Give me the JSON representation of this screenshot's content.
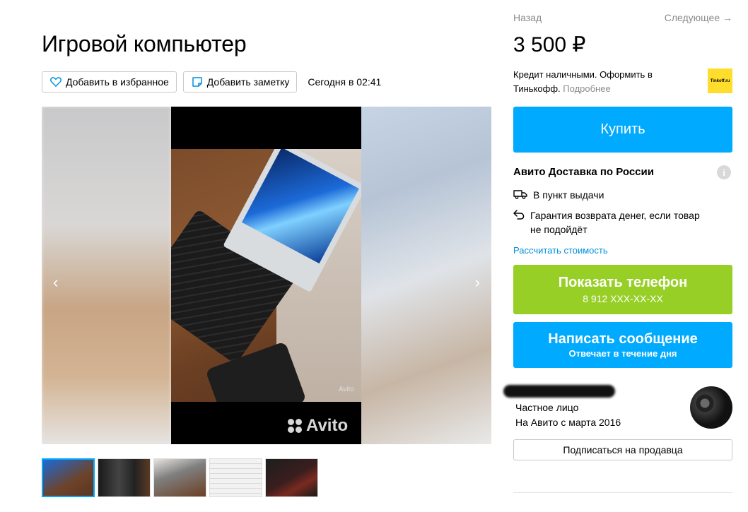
{
  "listing": {
    "title": "Игровой компьютер",
    "posted": "Сегодня в 02:41",
    "price": "3 500 ₽"
  },
  "actions": {
    "favorite_label": "Добавить в избранное",
    "note_label": "Добавить заметку"
  },
  "nav": {
    "back": "Назад",
    "next": "Следующее →"
  },
  "gallery": {
    "prev_arrow": "‹",
    "next_arrow": "›",
    "watermark_small": "Avito",
    "watermark_big": "Avito",
    "thumbnail_count": 5,
    "active_thumbnail": 1
  },
  "credit": {
    "text": "Кредит наличными. Оформить в Тинькофф.",
    "more": "Подробнее",
    "logo_text": "Tinkoff.ru"
  },
  "buy": {
    "label": "Купить"
  },
  "delivery": {
    "title": "Авито Доставка по России",
    "info_icon": "i",
    "pickup": "В пункт выдачи",
    "guarantee": "Гарантия возврата денег, если товар не подойдёт",
    "calc_link": "Рассчитать стоимость"
  },
  "phone": {
    "label": "Показать телефон",
    "number": "8 912 XXX-XX-XX"
  },
  "message": {
    "label": "Написать сообщение",
    "sub": "Отвечает в течение дня"
  },
  "seller": {
    "type": "Частное лицо",
    "since": "На Авито с марта 2016",
    "subscribe": "Подписаться на продавца"
  },
  "colors": {
    "accent_blue": "#00aaff",
    "phone_green": "#97cf26",
    "link_blue": "#0091d9",
    "muted": "#8a8a8a"
  },
  "icons": [
    "heart-icon",
    "note-icon",
    "truck-icon",
    "return-icon",
    "info-icon",
    "chevron-left-icon",
    "chevron-right-icon"
  ]
}
